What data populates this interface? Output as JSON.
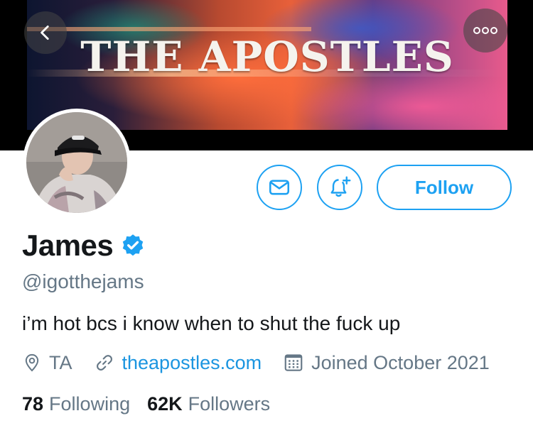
{
  "banner": {
    "title": "THE APOSTLES"
  },
  "profile": {
    "display_name": "James",
    "verified": true,
    "handle": "@igotthejams",
    "bio": "i’m hot bcs i know when to shut the fuck up",
    "location": "TA",
    "website": "theapostles.com",
    "joined": "Joined October 2021"
  },
  "actions": {
    "follow_label": "Follow"
  },
  "stats": {
    "following_count": "78",
    "following_label": "Following",
    "followers_count": "62K",
    "followers_label": "Followers"
  },
  "icons": {
    "back": "chevron-left-icon",
    "more": "more-horizontal-icon",
    "message": "envelope-icon",
    "notify": "bell-plus-icon",
    "verified": "verified-badge-icon",
    "location": "location-pin-icon",
    "link": "link-icon",
    "calendar": "calendar-icon"
  },
  "colors": {
    "accent": "#1da1f2",
    "secondary_text": "#657786",
    "link": "#1b95e0"
  }
}
